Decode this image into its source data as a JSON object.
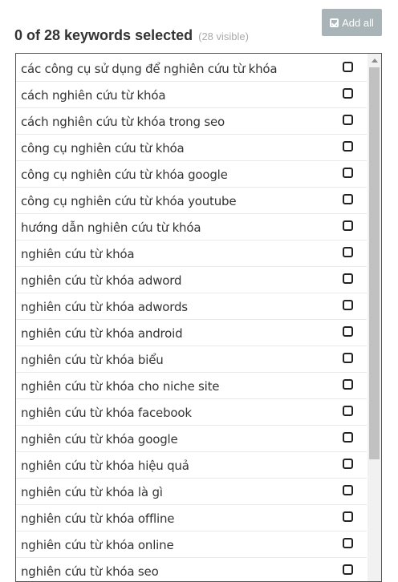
{
  "header": {
    "title": "0 of 28 keywords selected",
    "visible_note": "(28 visible)",
    "add_all_label": "Add all",
    "add_all_icon": "check-square-icon"
  },
  "colors": {
    "add_all_bg": "#a9b4b9",
    "list_border": "#555555",
    "row_divider": "#e9e9e9"
  },
  "keywords": [
    {
      "text": "các công cụ sử dụng để nghiên cứu từ khóa",
      "checked": false
    },
    {
      "text": "cách nghiên cứu từ khóa",
      "checked": false
    },
    {
      "text": "cách nghiên cứu từ khóa trong seo",
      "checked": false
    },
    {
      "text": "công cụ nghiên cứu từ khóa",
      "checked": false
    },
    {
      "text": "công cụ nghiên cứu từ khóa google",
      "checked": false
    },
    {
      "text": "công cụ nghiên cứu từ khóa youtube",
      "checked": false
    },
    {
      "text": "hướng dẫn nghiên cứu từ khóa",
      "checked": false
    },
    {
      "text": "nghiên cứu từ khóa",
      "checked": false
    },
    {
      "text": "nghiên cứu từ khóa adword",
      "checked": false
    },
    {
      "text": "nghiên cứu từ khóa adwords",
      "checked": false
    },
    {
      "text": "nghiên cứu từ khóa android",
      "checked": false
    },
    {
      "text": "nghiên cứu từ khóa biểu",
      "checked": false
    },
    {
      "text": "nghiên cứu từ khóa cho niche site",
      "checked": false
    },
    {
      "text": "nghiên cứu từ khóa facebook",
      "checked": false
    },
    {
      "text": "nghiên cứu từ khóa google",
      "checked": false
    },
    {
      "text": "nghiên cứu từ khóa hiệu quả",
      "checked": false
    },
    {
      "text": "nghiên cứu từ khóa là gì",
      "checked": false
    },
    {
      "text": "nghiên cứu từ khóa offline",
      "checked": false
    },
    {
      "text": "nghiên cứu từ khóa online",
      "checked": false
    },
    {
      "text": "nghiên cứu từ khóa seo",
      "checked": false
    }
  ]
}
